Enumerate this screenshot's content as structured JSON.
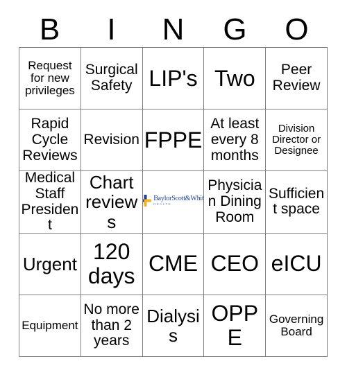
{
  "header": {
    "letters": [
      "B",
      "I",
      "N",
      "G",
      "O"
    ]
  },
  "logo": {
    "name": "BaylorScott&White",
    "sub": "HEALTH",
    "mark_icon": "cross-icon",
    "blue": "#1c3f94",
    "gold": "#f0b323",
    "light_blue": "#5a7fc0"
  },
  "grid": {
    "rows": [
      [
        {
          "text": "Request for new privileges",
          "size": "fs-sm"
        },
        {
          "text": "Surgical Safety",
          "size": "fs-md"
        },
        {
          "text": "LIP's",
          "size": "fs-xl"
        },
        {
          "text": "Two",
          "size": "fs-xl"
        },
        {
          "text": "Peer Review",
          "size": "fs-md"
        }
      ],
      [
        {
          "text": "Rapid Cycle Reviews",
          "size": "fs-md"
        },
        {
          "text": "Revision",
          "size": "fs-md"
        },
        {
          "text": "FPPE",
          "size": "fs-xl"
        },
        {
          "text": "At least every 8 months",
          "size": "fs-md"
        },
        {
          "text": "Division Director or Designee",
          "size": "fs-xs"
        }
      ],
      [
        {
          "text": "Medical Staff President",
          "size": "fs-md"
        },
        {
          "text": "Chart reviews",
          "size": "fs-lg"
        },
        {
          "text": "",
          "size": "free"
        },
        {
          "text": "Physician Dining Room",
          "size": "fs-md"
        },
        {
          "text": "Sufficient space",
          "size": "fs-md"
        }
      ],
      [
        {
          "text": "Urgent",
          "size": "fs-lg"
        },
        {
          "text": "120 days",
          "size": "fs-xl"
        },
        {
          "text": "CME",
          "size": "fs-xl"
        },
        {
          "text": "CEO",
          "size": "fs-xl"
        },
        {
          "text": "eICU",
          "size": "fs-xl"
        }
      ],
      [
        {
          "text": "Equipment",
          "size": "fs-sm"
        },
        {
          "text": "No more than 2 years",
          "size": "fs-md"
        },
        {
          "text": "Dialysis",
          "size": "fs-lg"
        },
        {
          "text": "OPPE",
          "size": "fs-xl"
        },
        {
          "text": "Governing Board",
          "size": "fs-sm"
        }
      ]
    ]
  }
}
